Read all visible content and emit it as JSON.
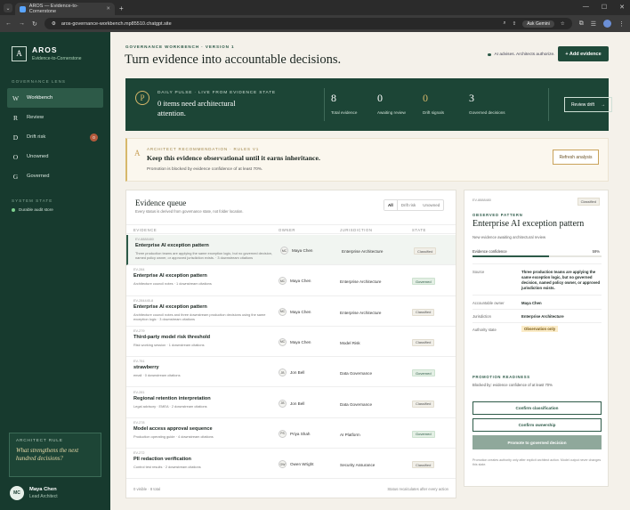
{
  "browser": {
    "tab_title": "AROS — Evidence-to-Cornerstone",
    "url": "aros-governance-workbench.mp85510.chatgpt.site",
    "ask_gemini": "Ask Gemini"
  },
  "sidebar": {
    "logo_letter": "A",
    "brand": "AROS",
    "brand_sub": "Evidence-to-Cornerstone",
    "lens_heading": "GOVERNANCE LENS",
    "items": [
      {
        "icon": "W",
        "label": "Workbench"
      },
      {
        "icon": "R",
        "label": "Review"
      },
      {
        "icon": "D",
        "label": "Drift risk",
        "badge": "0"
      },
      {
        "icon": "O",
        "label": "Unowned"
      },
      {
        "icon": "G",
        "label": "Governed"
      }
    ],
    "system_heading": "SYSTEM STATE",
    "system_status": "Durable audit store",
    "rule_heading": "ARCHITECT RULE",
    "rule_question": "What strengthens the next hundred decisions?",
    "user_initials": "MC",
    "user_name": "Maya Chen",
    "user_role": "Lead Architect"
  },
  "header": {
    "eyebrow": "GOVERNANCE WORKBENCH · VERSION 1",
    "title": "Turn evidence into accountable decisions.",
    "advisory": "AI advises. Architects authorize.",
    "add_button": "+ Add evidence"
  },
  "pulse": {
    "icon": "P",
    "heading": "DAILY PULSE · LIVE FROM EVIDENCE STATE",
    "title": "0 items need architectural attention.",
    "stats": [
      {
        "value": "8",
        "label": "Total evidence"
      },
      {
        "value": "0",
        "label": "Awaiting review"
      },
      {
        "value": "0",
        "label": "Drift signals"
      },
      {
        "value": "3",
        "label": "Governed decisions"
      }
    ],
    "review_button": "Review drift",
    "review_arrow": "→"
  },
  "recommendation": {
    "icon": "A",
    "heading": "ARCHITECT RECOMMENDATION · RULES V1",
    "title": "Keep this evidence observational until it earns inheritance.",
    "subtitle": "Promotion is blocked by evidence confidence of at least 70%.",
    "refresh_button": "Refresh analysis"
  },
  "queue": {
    "title": "Evidence queue",
    "subtitle": "Every status is derived from governance state, not folder location.",
    "filters": [
      "All",
      "Drift risk",
      "Unowned"
    ],
    "columns": [
      "EVIDENCE",
      "OWNER",
      "JURISDICTION",
      "STATE"
    ],
    "rows": [
      {
        "id": "EV-8888480",
        "title": "Enterprise AI exception pattern",
        "desc": "Three production teams are applying the same exception logic, but no governed decision, named policy owner, or approved jurisdiction exists. · 3 downstream citations",
        "owner_initials": "MC",
        "owner": "Maya Chen",
        "jurisdiction": "Enterprise Architecture",
        "state": "Classified"
      },
      {
        "id": "EV-284",
        "title": "Enterprise AI exception pattern",
        "desc": "Architecture council notes · 1 downstream citations",
        "owner_initials": "MC",
        "owner": "Maya Chen",
        "jurisdiction": "Enterprise Architecture",
        "state": "Governed"
      },
      {
        "id": "EV-284445-8",
        "title": "Enterprise AI exception pattern",
        "desc": "Architecture council notes and three downstream production decisions using the same exception logic · 3 downstream citations",
        "owner_initials": "MC",
        "owner": "Maya Chen",
        "jurisdiction": "Enterprise Architecture",
        "state": "Classified"
      },
      {
        "id": "EV-279",
        "title": "Third-party model risk threshold",
        "desc": "Risk working session · 1 downstream citations",
        "owner_initials": "MC",
        "owner": "Maya Chen",
        "jurisdiction": "Model Risk",
        "state": "Classified"
      },
      {
        "id": "EV-751",
        "title": "strawberry",
        "desc": "email · 0 downstream citations",
        "owner_initials": "JB",
        "owner": "Jon Bell",
        "jurisdiction": "Data Governance",
        "state": "Governed"
      },
      {
        "id": "EV-281",
        "title": "Regional retention interpretation",
        "desc": "Legal advisory · EMEA · 2 downstream citations",
        "owner_initials": "JB",
        "owner": "Jon Bell",
        "jurisdiction": "Data Governance",
        "state": "Classified"
      },
      {
        "id": "EV-278",
        "title": "Model access approval sequence",
        "desc": "Production operating guide · 4 downstream citations",
        "owner_initials": "PS",
        "owner": "Priya Shah",
        "jurisdiction": "AI Platform",
        "state": "Governed"
      },
      {
        "id": "EV-272",
        "title": "PII redaction verification",
        "desc": "Control test results · 2 downstream citations",
        "owner_initials": "OW",
        "owner": "Owen Wright",
        "jurisdiction": "Security Assurance",
        "state": "Classified"
      }
    ],
    "footer_left": "0 visible · 8 total",
    "footer_right": "Status recalculates after every action"
  },
  "detail": {
    "id": "EV-8888480",
    "badge": "Classified",
    "eyebrow": "OBSERVED PATTERN",
    "title": "Enterprise AI exception pattern",
    "subtitle": "New evidence awaiting architectural review",
    "confidence_label": "Evidence confidence",
    "confidence_value": "59%",
    "confidence_fraction": 0.59,
    "source_label": "Source",
    "source_value": "Three production teams are applying the same exception logic, but no governed decision, named policy owner, or approved jurisdiction exists.",
    "owner_label": "Accountable owner",
    "owner_value": "Maya Chen",
    "jurisdiction_label": "Jurisdiction",
    "jurisdiction_value": "Enterprise Architecture",
    "authority_label": "Authority state",
    "authority_value": "Observation only",
    "promotion_heading": "PROMOTION READINESS",
    "promotion_text": "Blocked by: evidence confidence of at least 70%",
    "confirm_classification": "Confirm classification",
    "confirm_ownership": "Confirm ownership",
    "promote": "Promote to governed decision",
    "note": "Promotion creates authority only after explicit architect action. Model output never changes this state."
  }
}
